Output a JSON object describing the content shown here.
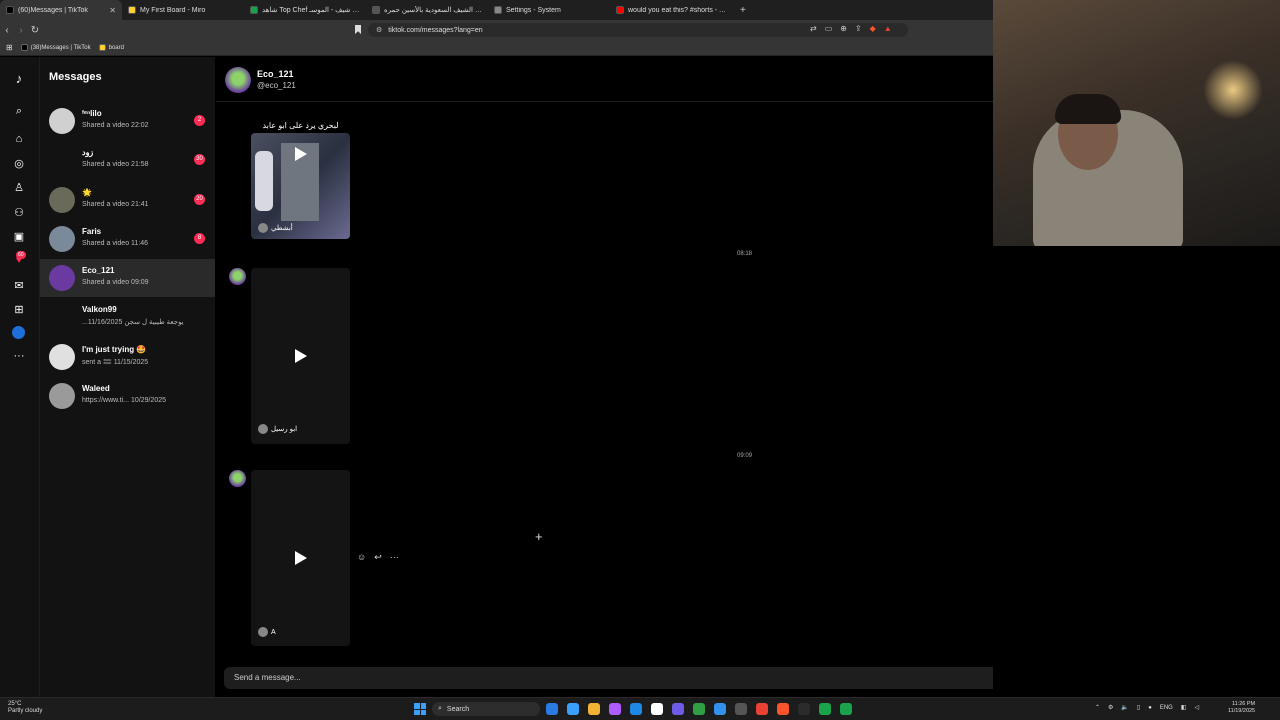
{
  "browser": {
    "tabs": [
      {
        "title": "(60)Messages | TikTok",
        "active": true,
        "color": "#000000"
      },
      {
        "title": "My First Board - Miro",
        "active": false,
        "color": "#ffd02f"
      },
      {
        "title": "شاهد Top Chef مش أي شيف - الموسـ",
        "active": false,
        "color": "#16a34a"
      },
      {
        "title": "الشيف السعودية بالأسين حمره - Search",
        "active": false,
        "color": "#555555"
      },
      {
        "title": "Settings - System",
        "active": false,
        "color": "#888888"
      },
      {
        "title": "would you eat this? #shorts - YouTube",
        "active": false,
        "color": "#ff0000"
      }
    ],
    "new_tab": "+",
    "url": "tiktok.com/messages?lang=en",
    "bookmarks": [
      {
        "label": "(38)Messages | TikTok",
        "color": "#000000"
      },
      {
        "label": "board",
        "color": "#ffd02f"
      }
    ]
  },
  "rail": {
    "icons": [
      "tiktok-logo-icon",
      "search-icon",
      "home-icon",
      "explore-icon",
      "following-icon",
      "friends-icon",
      "live-icon",
      "activity-icon",
      "messages-icon",
      "upload-icon",
      "profile-icon",
      "more-icon"
    ],
    "activity_badge": "60"
  },
  "messages": {
    "title": "Messages",
    "conversations": [
      {
        "name": "ᶠᵉⁿlilo",
        "preview": "Shared a video",
        "time": "22:02",
        "badge": "2",
        "avatar_color": "#d0d0d0"
      },
      {
        "name": "زود",
        "preview": "Shared a video",
        "time": "21:58",
        "badge": "30",
        "avatar_color": "#121212"
      },
      {
        "name": "🌟",
        "preview": "Shared a video",
        "time": "21:41",
        "badge": "20",
        "avatar_color": "#6a6a5a"
      },
      {
        "name": "Faris",
        "preview": "Shared a video",
        "time": "11:46",
        "badge": "8",
        "avatar_color": "#7a8a9a"
      },
      {
        "name": "Eco_121",
        "preview": "Shared a video",
        "time": "09:09",
        "badge": "",
        "avatar_color": "#6a3aa0",
        "active": true
      },
      {
        "name": "Valkon99",
        "preview": "...يوجعة طيبية ل سجن",
        "time": "11/16/2025",
        "badge": "",
        "avatar_color": "#121212"
      },
      {
        "name": "I'm just trying 🤩",
        "preview": "sent a 🟰",
        "time": "11/15/2025",
        "badge": "",
        "avatar_color": "#e0e0e0"
      },
      {
        "name": "Waleed",
        "preview": "https://www.ti...",
        "time": "10/29/2025",
        "badge": "",
        "avatar_color": "#9a9a9a"
      }
    ]
  },
  "chat": {
    "name": "Eco_121",
    "handle": "@eco_121",
    "videos": [
      {
        "caption": "لبحري يرد على ابو عابد",
        "author": "أبشطي",
        "time_after": "08:18"
      },
      {
        "caption": "",
        "author": "ابو رسيل",
        "time_after": "09:09"
      },
      {
        "caption": "",
        "author": "A",
        "time_after": ""
      }
    ],
    "composer_placeholder": "Send a message..."
  },
  "taskbar": {
    "weather_temp": "25°C",
    "weather_desc": "Partly cloudy",
    "search_label": "Search",
    "lang": "ENG",
    "time": "11:26 PM",
    "date": "11/19/2025",
    "apps": [
      "#2a7ae2",
      "#3aa0ff",
      "#f2b233",
      "#ad5cff",
      "#1e88e5",
      "#ffffff",
      "#6e5ce8",
      "#2ea043",
      "#3390ec",
      "#555555",
      "#e94235",
      "#fb542b",
      "#2b2b2b",
      "#1aa34a",
      "#1aa34a"
    ]
  }
}
